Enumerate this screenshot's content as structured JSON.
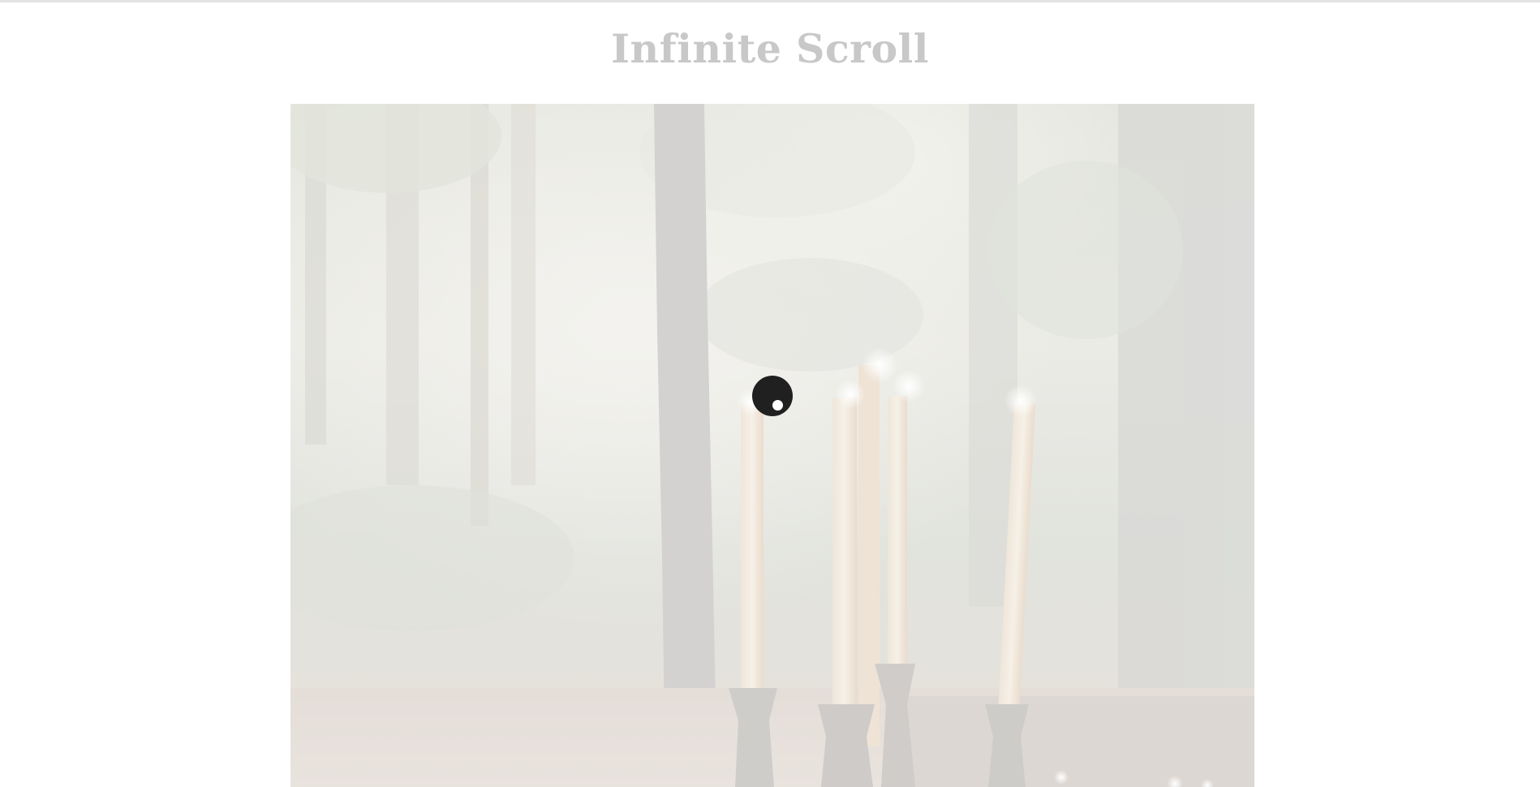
{
  "page": {
    "title": "Infinite Scroll"
  },
  "feed": {
    "items": [
      {
        "image": "forest-candles-photo",
        "faded": true
      }
    ]
  },
  "loader": {
    "icon": "loading-spinner-icon",
    "state": "loading"
  },
  "colors": {
    "title": "#c8c8c8",
    "loader": "#202020",
    "background": "#ffffff"
  }
}
